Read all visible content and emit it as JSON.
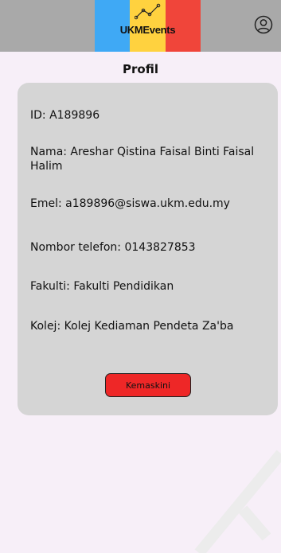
{
  "header": {
    "logo_text": "UKMEvents",
    "logo_colors": [
      "#3fa9f5",
      "#ffd23f",
      "#f0453a"
    ],
    "profile_icon": "user-circle-icon"
  },
  "page": {
    "title": "Profil"
  },
  "profile": {
    "id": "ID: A189896",
    "name": "Nama: Areshar Qistina Faisal Binti Faisal Halim",
    "email": "Emel: a189896@siswa.ukm.edu.my",
    "phone": "Nombor telefon: 0143827853",
    "faculty": "Fakulti: Fakulti Pendidikan",
    "college": "Kolej: Kolej Kediaman Pendeta Za'ba"
  },
  "actions": {
    "update_label": "Kemaskini"
  },
  "colors": {
    "header_bg": "#a9a9a9",
    "page_bg": "#f7eff8",
    "card_bg": "#d5d5d5",
    "button_bg": "#ee2727"
  }
}
